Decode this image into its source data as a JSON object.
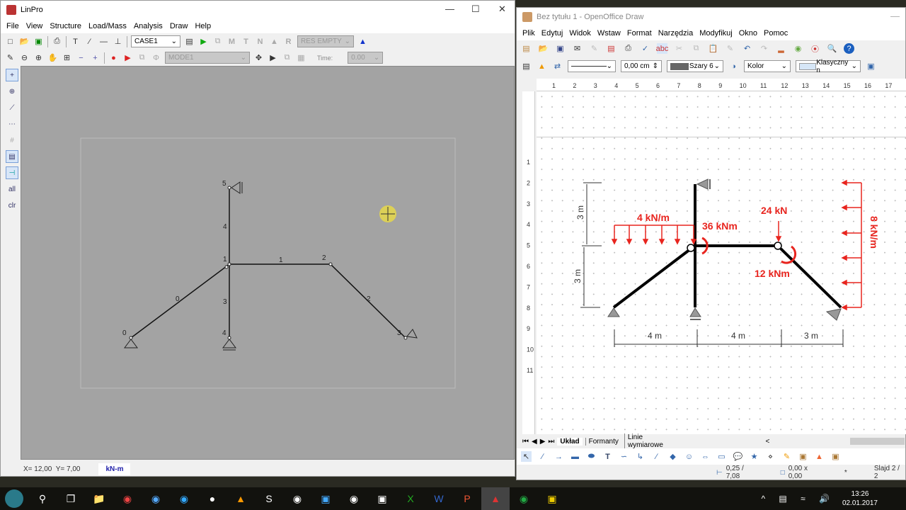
{
  "linpro": {
    "title": "LinPro",
    "menu": [
      "File",
      "View",
      "Structure",
      "Load/Mass",
      "Analysis",
      "Draw",
      "Help"
    ],
    "case_select": "CASE1",
    "results_select": "RES EMPTY",
    "mode_select": "MODE1",
    "time_label": "Time:",
    "time_value": "0.00",
    "side_tools": [
      "add-node",
      "add-support",
      "add-member",
      "split-member",
      "grid",
      "window",
      "snap"
    ],
    "side_all": "all",
    "side_clr": "clr",
    "nodes": [
      "0",
      "1",
      "2",
      "3",
      "4",
      "5"
    ],
    "members": [
      "0",
      "1",
      "2",
      "3",
      "4"
    ],
    "status_coords": "X= 12,00  Y= 7,00",
    "status_units": "kN-m"
  },
  "oo": {
    "title": "Bez tytułu 1 - OpenOffice Draw",
    "menu": [
      "Plik",
      "Edytuj",
      "Widok",
      "Wstaw",
      "Format",
      "Narzędzia",
      "Modyfikuj",
      "Okno",
      "Pomoc"
    ],
    "line_width": "0,00 cm",
    "line_color": "Szary 6",
    "area_style": "Kolor",
    "area_color": "Klasyczny n",
    "ruler": [
      "1",
      "2",
      "3",
      "4",
      "5",
      "6",
      "7",
      "8",
      "9",
      "10",
      "11",
      "12",
      "13",
      "14",
      "15",
      "16",
      "17"
    ],
    "vruler": [
      "1",
      "2",
      "3",
      "4",
      "5",
      "6",
      "7",
      "8",
      "9",
      "10",
      "11"
    ],
    "drawing": {
      "dist_load_h": "4 kN/m",
      "moment1": "36 kNm",
      "force": "24 kN",
      "moment2": "12 kNm",
      "dist_load_v": "8 kN/m",
      "dim_top": "3 m",
      "dim_bottom": "3 m",
      "dim_x1": "4 m",
      "dim_x2": "4 m",
      "dim_x3": "3 m"
    },
    "tabs": [
      "Układ",
      "Formanty",
      "Linie wymiarowe"
    ],
    "status_pos": "0,25 / 7,08",
    "status_size": "0,00 x 0,00",
    "status_slide": "Slajd 2 / 2",
    "colors": {
      "load": "#e8251f"
    }
  },
  "taskbar": {
    "time": "13:26",
    "date": "02.01.2017"
  }
}
